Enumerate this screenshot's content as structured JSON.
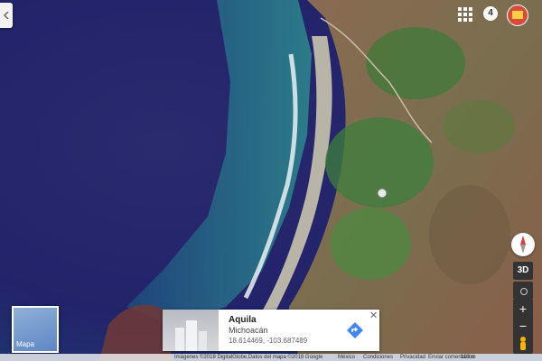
{
  "map": {
    "view": "satellite",
    "pin_icon": "place-marker-icon"
  },
  "top_bar": {
    "apps_icon": "apps-grid-icon",
    "notifications_count": "4",
    "avatar_icon": "account-avatar-icon"
  },
  "controls": {
    "compass_icon": "compass-icon",
    "tilt_label": "3D",
    "location_icon": "my-location-icon",
    "zoom_in": "+",
    "zoom_out": "−",
    "pegman_icon": "pegman-icon"
  },
  "minimap": {
    "label": "Mapa"
  },
  "place_card": {
    "title": "Aquila",
    "region": "Michoacán",
    "coordinates": "18.614469, -103.687489",
    "directions_icon": "directions-icon",
    "close_icon": "close-icon"
  },
  "footer": {
    "imagery": "Imágenes ©2018 DigitalGlobe,Datos del mapa ©2018 Google",
    "country": "México",
    "terms": "Condiciones",
    "privacy": "Privacidad",
    "feedback": "Enviar comentarios",
    "scale": "100 m"
  }
}
